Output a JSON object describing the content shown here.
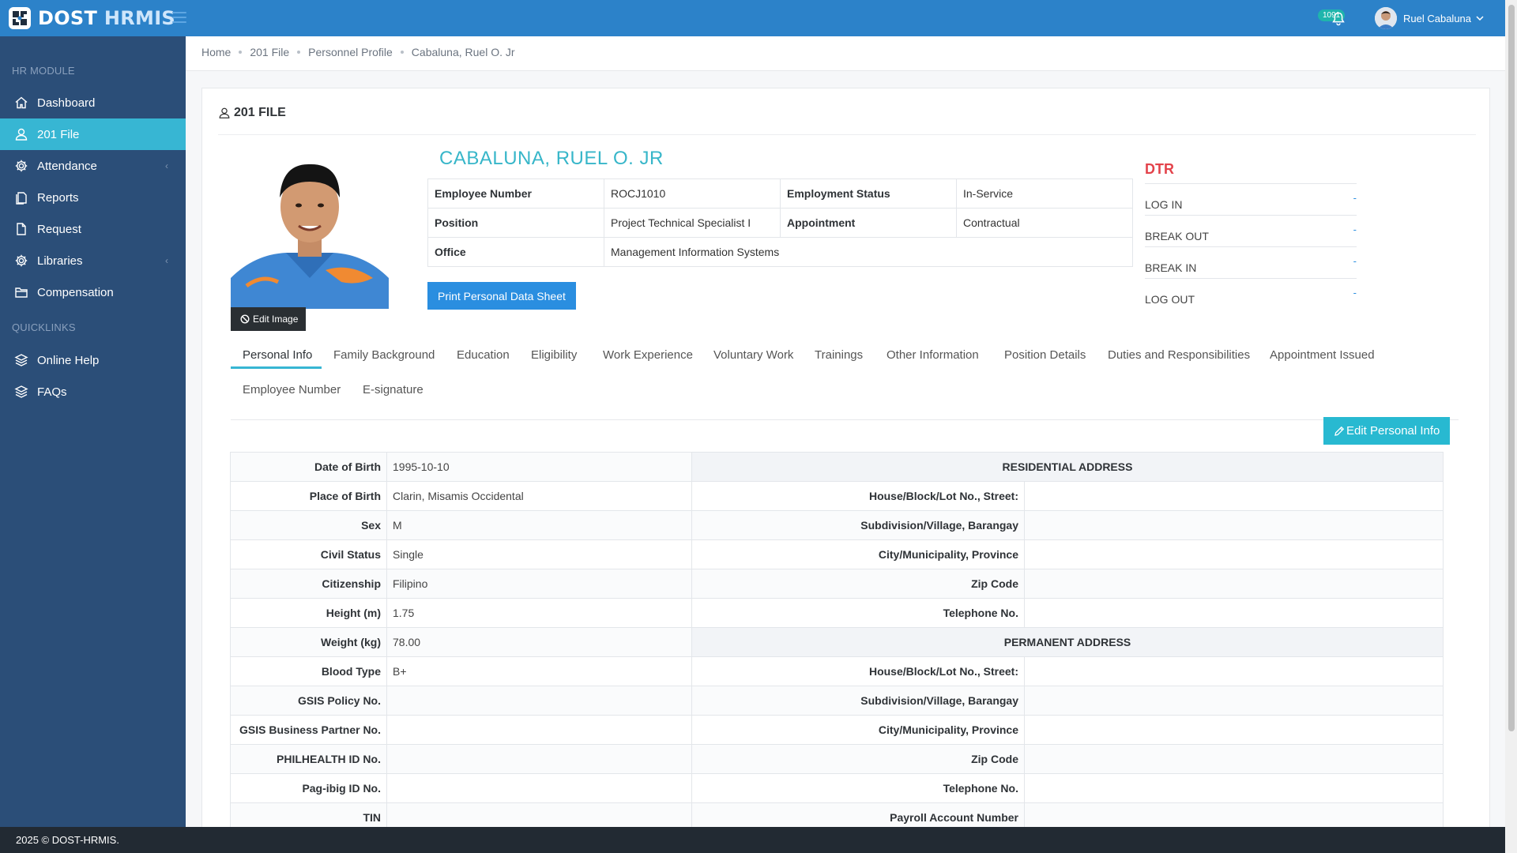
{
  "brand": {
    "part1": "DOST",
    "part2": "HRMIS"
  },
  "header": {
    "notification_count": "1091",
    "user_name": "Ruel Cabaluna"
  },
  "sidebar": {
    "section_hr": "HR MODULE",
    "section_quick": "QUICKLINKS",
    "items": [
      {
        "label": "Dashboard",
        "icon": "home-icon"
      },
      {
        "label": "201 File",
        "icon": "user-icon",
        "active": true
      },
      {
        "label": "Attendance",
        "icon": "gear-icon",
        "has_children": true
      },
      {
        "label": "Reports",
        "icon": "documents-icon"
      },
      {
        "label": "Request",
        "icon": "file-icon"
      },
      {
        "label": "Libraries",
        "icon": "gear-icon",
        "has_children": true
      },
      {
        "label": "Compensation",
        "icon": "folder-icon"
      }
    ],
    "quicklinks": [
      {
        "label": "Online Help",
        "icon": "layers-icon"
      },
      {
        "label": "FAQs",
        "icon": "layers-icon"
      }
    ]
  },
  "breadcrumb": [
    "Home",
    "201 File",
    "Personnel Profile",
    "Cabaluna, Ruel O. Jr"
  ],
  "card": {
    "title": "201 FILE",
    "edit_image": "Edit Image"
  },
  "employee": {
    "name": "CABALUNA, RUEL O. JR",
    "employee_number_label": "Employee Number",
    "employee_number": "ROCJ1010",
    "employment_status_label": "Employment Status",
    "employment_status": "In-Service",
    "position_label": "Position",
    "position": "Project Technical Specialist I",
    "appointment_label": "Appointment",
    "appointment": "Contractual",
    "office_label": "Office",
    "office": "Management Information Systems",
    "print_button": "Print Personal Data Sheet"
  },
  "dtr": {
    "title": "DTR",
    "rows": [
      {
        "label": "LOG IN",
        "value": "-"
      },
      {
        "label": "BREAK OUT",
        "value": "-"
      },
      {
        "label": "BREAK IN",
        "value": "-"
      },
      {
        "label": "LOG OUT",
        "value": "-"
      }
    ]
  },
  "tabs": [
    "Personal Info",
    "Family Background",
    "Education",
    "Eligibility",
    "Work Experience",
    "Voluntary Work",
    "Trainings",
    "Other Information",
    "Position Details",
    "Duties and Responsibilities",
    "Appointment Issued",
    "Employee Number",
    "E-signature"
  ],
  "edit_personal_info": "Edit Personal Info",
  "personal_info": {
    "rows": [
      {
        "label": "Date of Birth",
        "value": "1995-10-10"
      },
      {
        "label": "Place of Birth",
        "value": "Clarin, Misamis Occidental"
      },
      {
        "label": "Sex",
        "value": "M"
      },
      {
        "label": "Civil Status",
        "value": "Single"
      },
      {
        "label": "Citizenship",
        "value": "Filipino"
      },
      {
        "label": "Height (m)",
        "value": "1.75"
      },
      {
        "label": "Weight (kg)",
        "value": "78.00"
      },
      {
        "label": "Blood Type",
        "value": "B+"
      },
      {
        "label": "GSIS Policy No.",
        "value": ""
      },
      {
        "label": "GSIS Business Partner No.",
        "value": ""
      },
      {
        "label": "PHILHEALTH ID No.",
        "value": ""
      },
      {
        "label": "Pag-ibig ID No.",
        "value": ""
      },
      {
        "label": "TIN",
        "value": ""
      }
    ],
    "address": {
      "residential_header": "RESIDENTIAL ADDRESS",
      "permanent_header": "PERMANENT ADDRESS",
      "house": "House/Block/Lot No., Street:",
      "subdivision": "Subdivision/Village, Barangay",
      "city": "City/Municipality, Province",
      "zip": "Zip Code",
      "telephone": "Telephone No.",
      "payroll": "Payroll Account Number"
    }
  },
  "footer": "2025 © DOST-HRMIS."
}
